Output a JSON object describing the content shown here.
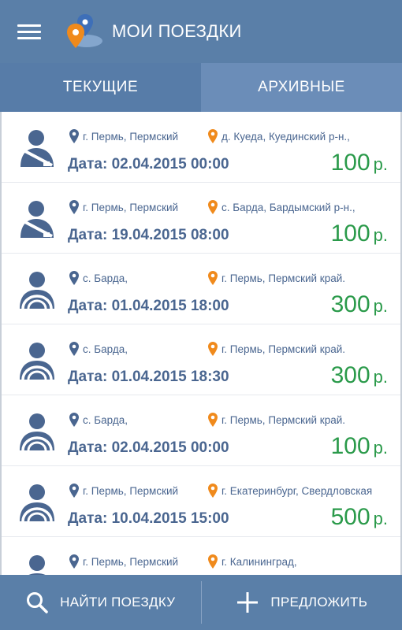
{
  "app": {
    "title": "МОИ ПОЕЗДКИ"
  },
  "tabs": [
    {
      "label": "ТЕКУЩИЕ"
    },
    {
      "label": "АРХИВНЫЕ"
    }
  ],
  "trips": [
    {
      "avatar": "seatbelt-passenger-icon",
      "from": "г. Пермь, Пермский",
      "to": "д. Куеда, Куединский р-н.,",
      "date": "Дата: 02.04.2015 00:00",
      "price": "100",
      "currency": "р."
    },
    {
      "avatar": "seatbelt-passenger-icon",
      "from": "г. Пермь, Пермский",
      "to": "с. Барда, Бардымский р-н.,",
      "date": "Дата: 19.04.2015 08:00",
      "price": "100",
      "currency": "р."
    },
    {
      "avatar": "driver-steering-wheel-icon",
      "from": "с. Барда,",
      "to": "г. Пермь, Пермский край.",
      "date": "Дата: 01.04.2015 18:00",
      "price": "300",
      "currency": "р."
    },
    {
      "avatar": "driver-steering-wheel-icon",
      "from": "с. Барда,",
      "to": "г. Пермь, Пермский край.",
      "date": "Дата: 01.04.2015 18:30",
      "price": "300",
      "currency": "р."
    },
    {
      "avatar": "driver-steering-wheel-icon",
      "from": "с. Барда,",
      "to": "г. Пермь, Пермский край.",
      "date": "Дата: 02.04.2015 00:00",
      "price": "100",
      "currency": "р."
    },
    {
      "avatar": "driver-steering-wheel-icon",
      "from": "г. Пермь, Пермский",
      "to": "г. Екатеринбург, Свердловская",
      "date": "Дата: 10.04.2015 15:00",
      "price": "500",
      "currency": "р."
    },
    {
      "avatar": "driver-steering-wheel-icon",
      "from": "г. Пермь, Пермский",
      "to": "г. Калининград,",
      "date": "",
      "price": "",
      "currency": ""
    }
  ],
  "bottom": {
    "find_label": "НАЙТИ ПОЕЗДКУ",
    "offer_label": "ПРЕДЛОЖИТЬ"
  },
  "colors": {
    "header": "#5a7fa8",
    "text_blue": "#4a6690",
    "price_green": "#2a9a4a",
    "origin_pin": "#4a6690",
    "destination_pin": "#f08a1c"
  }
}
